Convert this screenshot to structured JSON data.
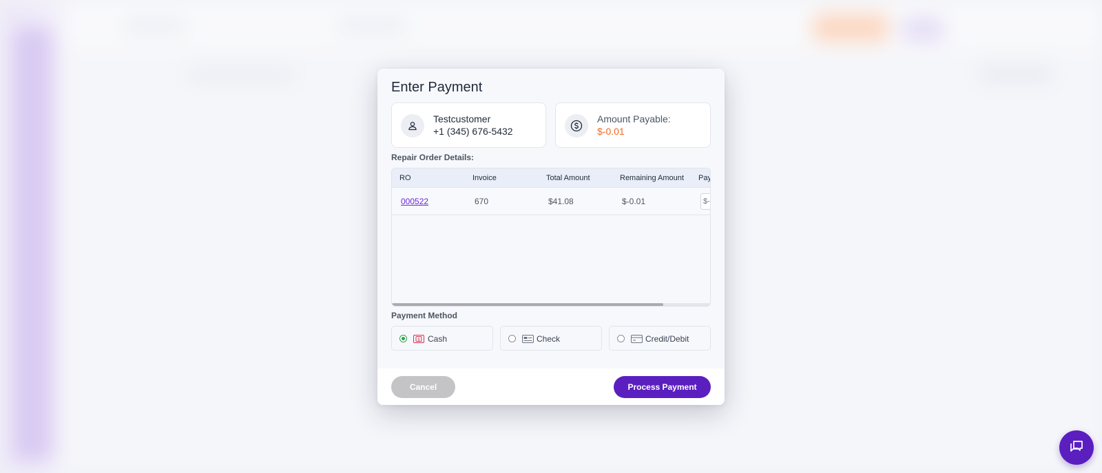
{
  "modal": {
    "title": "Enter Payment",
    "customer": {
      "name": "Testcustomer",
      "phone": "+1 (345) 676-5432",
      "icon": "user-icon"
    },
    "amount": {
      "label": "Amount Payable:",
      "value": "$-0.01",
      "icon": "dollar-circle-icon",
      "color": "#f26a22"
    },
    "repair_order_label": "Repair Order Details:",
    "table": {
      "columns": [
        "RO",
        "Invoice",
        "Total Amount",
        "Remaining Amount",
        "Pay"
      ],
      "rows": [
        {
          "ro": "000522",
          "invoice": "670",
          "total": "$41.08",
          "remaining": "$-0.01",
          "payment": "$-"
        }
      ]
    },
    "payment_method_label": "Payment Method",
    "payment_methods": [
      {
        "label": "Cash",
        "icon": "cash-icon",
        "selected": true
      },
      {
        "label": "Check",
        "icon": "check-icon",
        "selected": false
      },
      {
        "label": "Credit/Debit",
        "icon": "credit-card-icon",
        "selected": false
      }
    ],
    "buttons": {
      "cancel": "Cancel",
      "process": "Process Payment"
    }
  },
  "colors": {
    "accent": "#5b1fc0",
    "selected_radio": "#2aa34a",
    "amount": "#f26a22"
  },
  "chat_fab": {
    "icon": "chat-icon"
  }
}
